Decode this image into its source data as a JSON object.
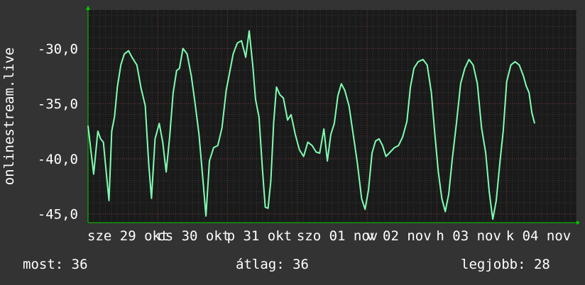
{
  "chart_data": {
    "type": "line",
    "ylabel": "onlinestream.live",
    "ylim": [
      -45.8,
      -26.5
    ],
    "yticks": [
      -30,
      -35,
      -40,
      -45
    ],
    "ytick_labels": [
      "-30,0",
      "-35,0",
      "-40,0",
      "-45,0"
    ],
    "xlim": [
      0,
      7
    ],
    "xticks": [
      {
        "pos": 0.0,
        "label": "sze 29 okt"
      },
      {
        "pos": 1.0,
        "label": "cs 30 okt"
      },
      {
        "pos": 2.0,
        "label": "p 31 okt"
      },
      {
        "pos": 3.0,
        "label": "szo 01 nov"
      },
      {
        "pos": 4.0,
        "label": "v 02 nov"
      },
      {
        "pos": 5.0,
        "label": "h 03 nov"
      },
      {
        "pos": 6.0,
        "label": "k 04 nov"
      }
    ],
    "grid": true,
    "colors": {
      "line": "#7fffb2",
      "background": "#1a1a1a",
      "grid": "#444444",
      "axis": "#00cc00"
    },
    "series": [
      {
        "points": [
          [
            0.0,
            -37.0
          ],
          [
            0.08,
            -41.4
          ],
          [
            0.14,
            -37.5
          ],
          [
            0.18,
            -38.2
          ],
          [
            0.22,
            -38.5
          ],
          [
            0.27,
            -41.8
          ],
          [
            0.3,
            -43.8
          ],
          [
            0.34,
            -37.5
          ],
          [
            0.38,
            -36.2
          ],
          [
            0.42,
            -33.5
          ],
          [
            0.47,
            -31.5
          ],
          [
            0.52,
            -30.5
          ],
          [
            0.58,
            -30.2
          ],
          [
            0.63,
            -30.8
          ],
          [
            0.7,
            -31.5
          ],
          [
            0.76,
            -33.6
          ],
          [
            0.82,
            -35.2
          ],
          [
            0.87,
            -40.5
          ],
          [
            0.91,
            -43.6
          ],
          [
            0.96,
            -38.2
          ],
          [
            1.02,
            -36.8
          ],
          [
            1.07,
            -38.5
          ],
          [
            1.12,
            -41.2
          ],
          [
            1.17,
            -38.0
          ],
          [
            1.22,
            -34.0
          ],
          [
            1.27,
            -32.0
          ],
          [
            1.31,
            -31.8
          ],
          [
            1.36,
            -30.0
          ],
          [
            1.42,
            -30.5
          ],
          [
            1.48,
            -32.5
          ],
          [
            1.53,
            -34.8
          ],
          [
            1.59,
            -37.8
          ],
          [
            1.65,
            -42.2
          ],
          [
            1.69,
            -45.2
          ],
          [
            1.74,
            -40.2
          ],
          [
            1.8,
            -39.0
          ],
          [
            1.86,
            -38.8
          ],
          [
            1.92,
            -37.2
          ],
          [
            1.98,
            -33.8
          ],
          [
            2.02,
            -32.5
          ],
          [
            2.08,
            -30.5
          ],
          [
            2.14,
            -29.5
          ],
          [
            2.2,
            -29.3
          ],
          [
            2.26,
            -30.8
          ],
          [
            2.31,
            -28.4
          ],
          [
            2.36,
            -31.5
          ],
          [
            2.4,
            -34.6
          ],
          [
            2.45,
            -36.2
          ],
          [
            2.5,
            -41.0
          ],
          [
            2.54,
            -44.4
          ],
          [
            2.58,
            -44.5
          ],
          [
            2.62,
            -42.0
          ],
          [
            2.66,
            -36.8
          ],
          [
            2.7,
            -33.5
          ],
          [
            2.75,
            -34.2
          ],
          [
            2.8,
            -34.5
          ],
          [
            2.86,
            -36.5
          ],
          [
            2.91,
            -36.0
          ],
          [
            2.97,
            -37.8
          ],
          [
            3.03,
            -39.2
          ],
          [
            3.09,
            -39.8
          ],
          [
            3.15,
            -38.5
          ],
          [
            3.21,
            -38.8
          ],
          [
            3.27,
            -39.4
          ],
          [
            3.32,
            -39.5
          ],
          [
            3.38,
            -37.3
          ],
          [
            3.43,
            -40.2
          ],
          [
            3.48,
            -37.8
          ],
          [
            3.53,
            -36.8
          ],
          [
            3.58,
            -34.3
          ],
          [
            3.63,
            -33.2
          ],
          [
            3.68,
            -33.8
          ],
          [
            3.74,
            -35.2
          ],
          [
            3.8,
            -37.8
          ],
          [
            3.86,
            -40.4
          ],
          [
            3.92,
            -43.6
          ],
          [
            3.97,
            -44.6
          ],
          [
            4.02,
            -42.8
          ],
          [
            4.07,
            -39.5
          ],
          [
            4.12,
            -38.4
          ],
          [
            4.17,
            -38.2
          ],
          [
            4.22,
            -38.8
          ],
          [
            4.27,
            -39.8
          ],
          [
            4.33,
            -39.4
          ],
          [
            4.39,
            -39.0
          ],
          [
            4.45,
            -38.8
          ],
          [
            4.51,
            -38.0
          ],
          [
            4.57,
            -36.6
          ],
          [
            4.62,
            -33.5
          ],
          [
            4.67,
            -31.8
          ],
          [
            4.73,
            -31.2
          ],
          [
            4.8,
            -31.0
          ],
          [
            4.86,
            -31.5
          ],
          [
            4.92,
            -34.0
          ],
          [
            4.97,
            -37.8
          ],
          [
            5.02,
            -41.2
          ],
          [
            5.07,
            -43.6
          ],
          [
            5.12,
            -44.8
          ],
          [
            5.17,
            -43.2
          ],
          [
            5.22,
            -40.0
          ],
          [
            5.28,
            -36.8
          ],
          [
            5.34,
            -33.2
          ],
          [
            5.4,
            -31.8
          ],
          [
            5.46,
            -31.0
          ],
          [
            5.52,
            -31.5
          ],
          [
            5.58,
            -33.2
          ],
          [
            5.64,
            -37.2
          ],
          [
            5.7,
            -39.5
          ],
          [
            5.75,
            -43.0
          ],
          [
            5.8,
            -45.5
          ],
          [
            5.85,
            -43.8
          ],
          [
            5.9,
            -40.5
          ],
          [
            5.95,
            -37.5
          ],
          [
            6.0,
            -33.0
          ],
          [
            6.06,
            -31.5
          ],
          [
            6.12,
            -31.2
          ],
          [
            6.18,
            -31.5
          ],
          [
            6.24,
            -32.5
          ],
          [
            6.28,
            -33.4
          ],
          [
            6.32,
            -34.0
          ],
          [
            6.36,
            -35.8
          ],
          [
            6.4,
            -36.8
          ]
        ]
      }
    ]
  },
  "footer": {
    "now": "most: 36",
    "avg": "átlag: 36",
    "best": "legjobb: 28"
  }
}
